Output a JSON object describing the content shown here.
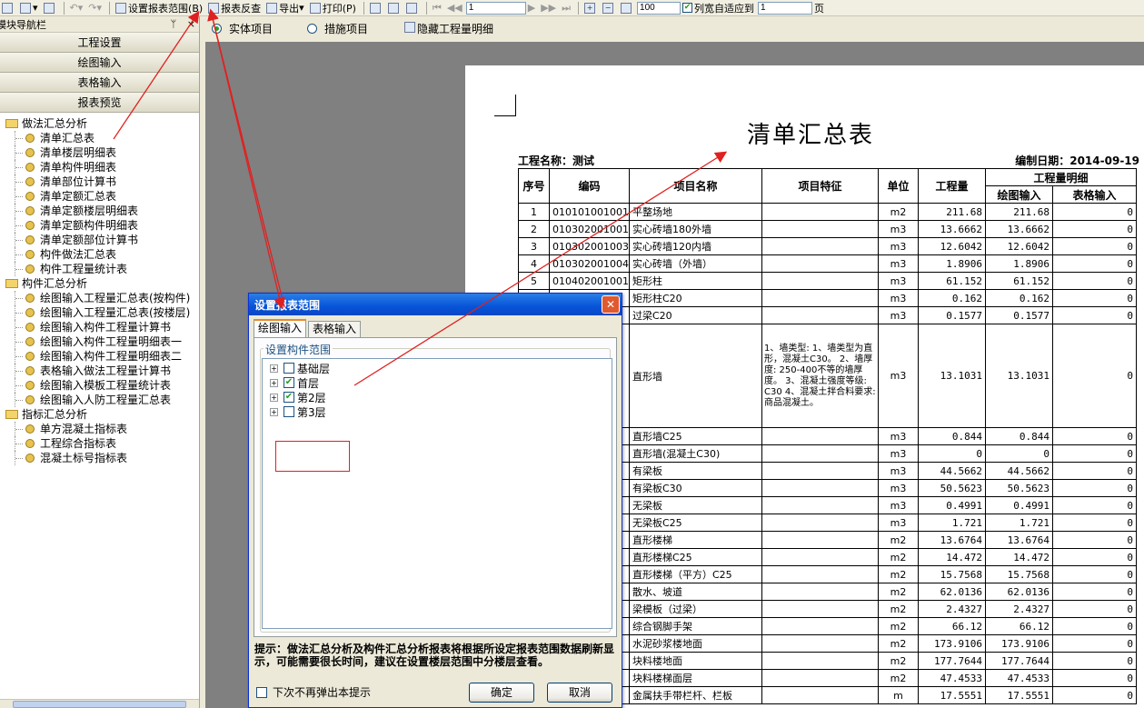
{
  "toolbar": {
    "set_range_label": "设置报表范围(B)",
    "reverse_label": "报表反查",
    "export_label": "导出",
    "print_label": "打印(P)",
    "page_value": "1",
    "zoom_value": "100",
    "fit_label": "列宽自适应到",
    "fit_value": "1",
    "page_unit": "页"
  },
  "panel": {
    "title": "模块导航栏",
    "pin": "ᛘ",
    "close": "×",
    "nav_buttons": [
      "工程设置",
      "绘图输入",
      "表格输入",
      "报表预览"
    ]
  },
  "tree": [
    {
      "type": "group",
      "label": "做法汇总分析"
    },
    {
      "type": "item",
      "label": "清单汇总表"
    },
    {
      "type": "item",
      "label": "清单楼层明细表"
    },
    {
      "type": "item",
      "label": "清单构件明细表"
    },
    {
      "type": "item",
      "label": "清单部位计算书"
    },
    {
      "type": "item",
      "label": "清单定额汇总表"
    },
    {
      "type": "item",
      "label": "清单定额楼层明细表"
    },
    {
      "type": "item",
      "label": "清单定额构件明细表"
    },
    {
      "type": "item",
      "label": "清单定额部位计算书"
    },
    {
      "type": "item",
      "label": "构件做法汇总表"
    },
    {
      "type": "item",
      "label": "构件工程量统计表"
    },
    {
      "type": "group",
      "label": "构件汇总分析"
    },
    {
      "type": "item",
      "label": "绘图输入工程量汇总表(按构件)"
    },
    {
      "type": "item",
      "label": "绘图输入工程量汇总表(按楼层)"
    },
    {
      "type": "item",
      "label": "绘图输入构件工程量计算书"
    },
    {
      "type": "item",
      "label": "绘图输入构件工程量明细表一"
    },
    {
      "type": "item",
      "label": "绘图输入构件工程量明细表二"
    },
    {
      "type": "item",
      "label": "表格输入做法工程量计算书"
    },
    {
      "type": "item",
      "label": "绘图输入模板工程量统计表"
    },
    {
      "type": "item",
      "label": "绘图输入人防工程量汇总表"
    },
    {
      "type": "group",
      "label": "指标汇总分析"
    },
    {
      "type": "item",
      "label": "单方混凝土指标表"
    },
    {
      "type": "item",
      "label": "工程综合指标表"
    },
    {
      "type": "item",
      "label": "混凝土标号指标表"
    }
  ],
  "radiobar": {
    "entity_label": "实体项目",
    "measure_label": "措施项目",
    "hide_label": "隐藏工程量明细"
  },
  "report": {
    "title": "清单汇总表",
    "project_label": "工程名称：测试",
    "date_label": "编制日期：2014-09-19",
    "headers": {
      "seq": "序号",
      "code": "编码",
      "name": "项目名称",
      "feature": "项目特征",
      "unit": "单位",
      "qty": "工程量",
      "detail": "工程量明细",
      "draw": "绘图输入",
      "table": "表格输入"
    },
    "rows": [
      {
        "seq": "1",
        "code": "010101001001",
        "name": "平整场地",
        "feature": "",
        "unit": "m2",
        "qty": "211.68",
        "draw": "211.68",
        "table": "0"
      },
      {
        "seq": "2",
        "code": "010302001001",
        "name": "实心砖墙180外墙",
        "feature": "",
        "unit": "m3",
        "qty": "13.6662",
        "draw": "13.6662",
        "table": "0"
      },
      {
        "seq": "3",
        "code": "010302001003",
        "name": "实心砖墙120内墙",
        "feature": "",
        "unit": "m3",
        "qty": "12.6042",
        "draw": "12.6042",
        "table": "0"
      },
      {
        "seq": "4",
        "code": "010302001004",
        "name": "实心砖墙（外墙）",
        "feature": "",
        "unit": "m3",
        "qty": "1.8906",
        "draw": "1.8906",
        "table": "0"
      },
      {
        "seq": "5",
        "code": "010402001001",
        "name": "矩形柱",
        "feature": "",
        "unit": "m3",
        "qty": "61.152",
        "draw": "61.152",
        "table": "0"
      },
      {
        "seq": "",
        "code": "",
        "name": "矩形柱C20",
        "feature": "",
        "unit": "m3",
        "qty": "0.162",
        "draw": "0.162",
        "table": "0"
      },
      {
        "seq": "",
        "code": "",
        "name": "过梁C20",
        "feature": "",
        "unit": "m3",
        "qty": "0.1577",
        "draw": "0.1577",
        "table": "0"
      },
      {
        "seq": "",
        "code": "",
        "name": "直形墙",
        "feature": "1、墙类型: 1、墙类型为直形，混凝土C30。 2、墙厚度: 250-400不等的墙厚度。 3、混凝土强度等级: C30 4、混凝土拌合料要求: 商品混凝土。",
        "unit": "m3",
        "qty": "13.1031",
        "draw": "13.1031",
        "table": "0"
      },
      {
        "seq": "",
        "code": "",
        "name": "直形墙C25",
        "feature": "",
        "unit": "m3",
        "qty": "0.844",
        "draw": "0.844",
        "table": "0"
      },
      {
        "seq": "",
        "code": "",
        "name": "直形墙(混凝土C30)",
        "feature": "",
        "unit": "m3",
        "qty": "0",
        "draw": "0",
        "table": "0"
      },
      {
        "seq": "",
        "code": "",
        "name": "有梁板",
        "feature": "",
        "unit": "m3",
        "qty": "44.5662",
        "draw": "44.5662",
        "table": "0"
      },
      {
        "seq": "",
        "code": "",
        "name": "有梁板C30",
        "feature": "",
        "unit": "m3",
        "qty": "50.5623",
        "draw": "50.5623",
        "table": "0"
      },
      {
        "seq": "",
        "code": "",
        "name": "无梁板",
        "feature": "",
        "unit": "m3",
        "qty": "0.4991",
        "draw": "0.4991",
        "table": "0"
      },
      {
        "seq": "",
        "code": "",
        "name": "无梁板C25",
        "feature": "",
        "unit": "m3",
        "qty": "1.721",
        "draw": "1.721",
        "table": "0"
      },
      {
        "seq": "",
        "code": "",
        "name": "直形楼梯",
        "feature": "",
        "unit": "m2",
        "qty": "13.6764",
        "draw": "13.6764",
        "table": "0"
      },
      {
        "seq": "",
        "code": "",
        "name": "直形楼梯C25",
        "feature": "",
        "unit": "m2",
        "qty": "14.472",
        "draw": "14.472",
        "table": "0"
      },
      {
        "seq": "",
        "code": "",
        "name": "直形楼梯（平方）C25",
        "feature": "",
        "unit": "m2",
        "qty": "15.7568",
        "draw": "15.7568",
        "table": "0"
      },
      {
        "seq": "",
        "code": "",
        "name": "散水、坡道",
        "feature": "",
        "unit": "m2",
        "qty": "62.0136",
        "draw": "62.0136",
        "table": "0"
      },
      {
        "seq": "",
        "code": "",
        "name": "梁模板（过梁）",
        "feature": "",
        "unit": "m2",
        "qty": "2.4327",
        "draw": "2.4327",
        "table": "0"
      },
      {
        "seq": "",
        "code": "",
        "name": "综合钢脚手架",
        "feature": "",
        "unit": "m2",
        "qty": "66.12",
        "draw": "66.12",
        "table": "0"
      },
      {
        "seq": "",
        "code": "",
        "name": "水泥砂浆楼地面",
        "feature": "",
        "unit": "m2",
        "qty": "173.9106",
        "draw": "173.9106",
        "table": "0"
      },
      {
        "seq": "",
        "code": "",
        "name": "块料楼地面",
        "feature": "",
        "unit": "m2",
        "qty": "177.7644",
        "draw": "177.7644",
        "table": "0"
      },
      {
        "seq": "",
        "code": "",
        "name": "块料楼梯面层",
        "feature": "",
        "unit": "m2",
        "qty": "47.4533",
        "draw": "47.4533",
        "table": "0"
      },
      {
        "seq": "",
        "code": "",
        "name": "金属扶手带栏杆、栏板",
        "feature": "",
        "unit": "m",
        "qty": "17.5551",
        "draw": "17.5551",
        "table": "0"
      }
    ]
  },
  "dialog": {
    "title": "设置报表范围",
    "close": "✕",
    "tabs": [
      "绘图输入",
      "表格输入"
    ],
    "group_label": "设置构件范围",
    "floors": [
      {
        "label": "基础层",
        "checked": false
      },
      {
        "label": "首层",
        "checked": true
      },
      {
        "label": "第2层",
        "checked": true
      },
      {
        "label": "第3层",
        "checked": false
      }
    ],
    "tip": "提示：做法汇总分析及构件汇总分析报表将根据所设定报表范围数据刷新显示，可能需要很长时间，建议在设置楼层范围中分楼层查看。",
    "dont_show": "下次不再弹出本提示",
    "ok": "确定",
    "cancel": "取消"
  },
  "colors": {
    "annotation": "#e02020",
    "title_bar": "#0753d8",
    "check": "#21a121"
  }
}
